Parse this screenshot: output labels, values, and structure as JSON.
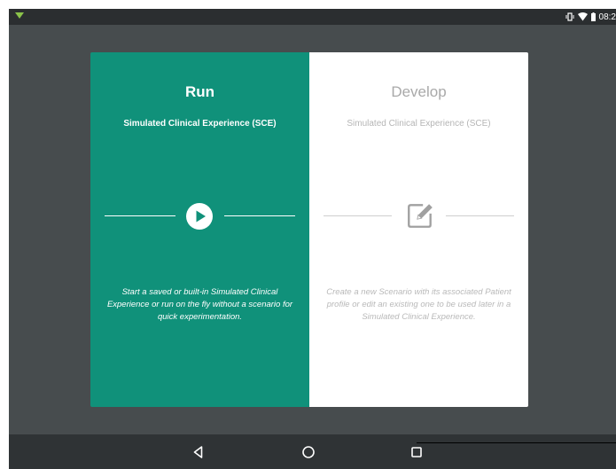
{
  "status_bar": {
    "time": "08:2",
    "icons": [
      "notification-arrow-icon",
      "vibrate-icon",
      "wifi-icon",
      "battery-icon"
    ]
  },
  "run_panel": {
    "title": "Run",
    "subtitle": "Simulated Clinical Experience (SCE)",
    "icon": "play-circle-icon",
    "description": "Start a saved or built-in Simulated Clinical Experience or run on the fly without a scenario for quick experimentation.",
    "color": "#10917a"
  },
  "develop_panel": {
    "title": "Develop",
    "subtitle": "Simulated Clinical Experience (SCE)",
    "icon": "edit-pencil-icon",
    "description": "Create a new Scenario with its associated Patient profile or edit an existing one to be used later in a Simulated Clinical Experience.",
    "color": "#ffffff"
  },
  "nav_bar": {
    "buttons": [
      "back-icon",
      "home-icon",
      "recents-icon"
    ]
  }
}
